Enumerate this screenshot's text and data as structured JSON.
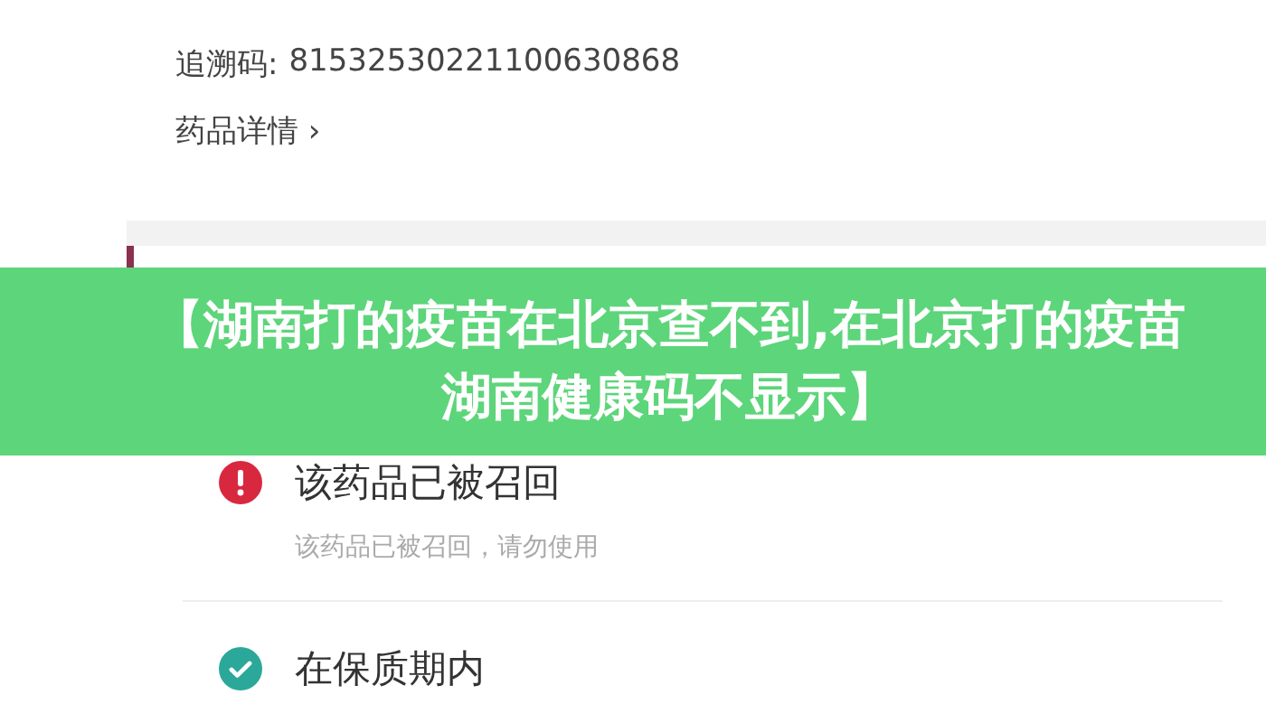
{
  "trace_code": {
    "label": "追溯码:",
    "value": "81532530221100630868"
  },
  "details_link": {
    "label": "药品详情",
    "icon": "›"
  },
  "statuses": [
    {
      "kind": "warning",
      "title": "该药品已被召回",
      "subtitle": "该药品已被召回，请勿使用"
    },
    {
      "kind": "ok",
      "title": "在保质期内"
    }
  ],
  "banner": {
    "text": "【湖南打的疫苗在北京查不到,在北京打的疫苗湖南健康码不显示】"
  }
}
